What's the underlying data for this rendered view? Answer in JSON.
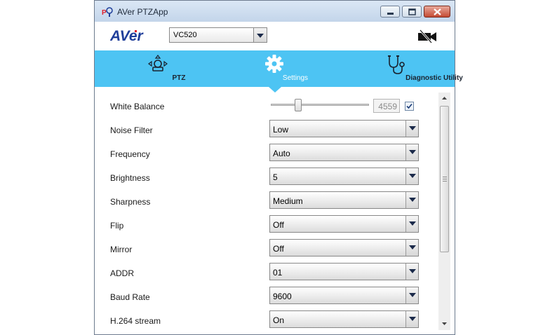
{
  "window": {
    "title": "AVer PTZApp"
  },
  "header": {
    "brand": "AVer",
    "model_select": {
      "value": "VC520"
    },
    "camera_icon": "camera-off-icon"
  },
  "nav": {
    "items": [
      {
        "label": "PTZ",
        "icon": "ptz-icon"
      },
      {
        "label": "Settings",
        "icon": "gear-icon",
        "active": true
      },
      {
        "label": "Diagnostic Utility",
        "icon": "stethoscope-icon"
      }
    ]
  },
  "settings": {
    "white_balance": {
      "label": "White Balance",
      "value": "4559",
      "auto_checked": true,
      "slider_fraction": 0.26
    },
    "rows": [
      {
        "label": "Noise Filter",
        "value": "Low"
      },
      {
        "label": "Frequency",
        "value": "Auto"
      },
      {
        "label": "Brightness",
        "value": "5"
      },
      {
        "label": "Sharpness",
        "value": "Medium"
      },
      {
        "label": "Flip",
        "value": "Off"
      },
      {
        "label": "Mirror",
        "value": "Off"
      },
      {
        "label": "ADDR",
        "value": "01"
      },
      {
        "label": "Baud Rate",
        "value": "9600"
      },
      {
        "label": "H.264 stream",
        "value": "On"
      }
    ]
  },
  "colors": {
    "nav_bar": "#4dc4f3",
    "brand_blue": "#1f3e9a",
    "brand_red": "#e01e2a"
  }
}
